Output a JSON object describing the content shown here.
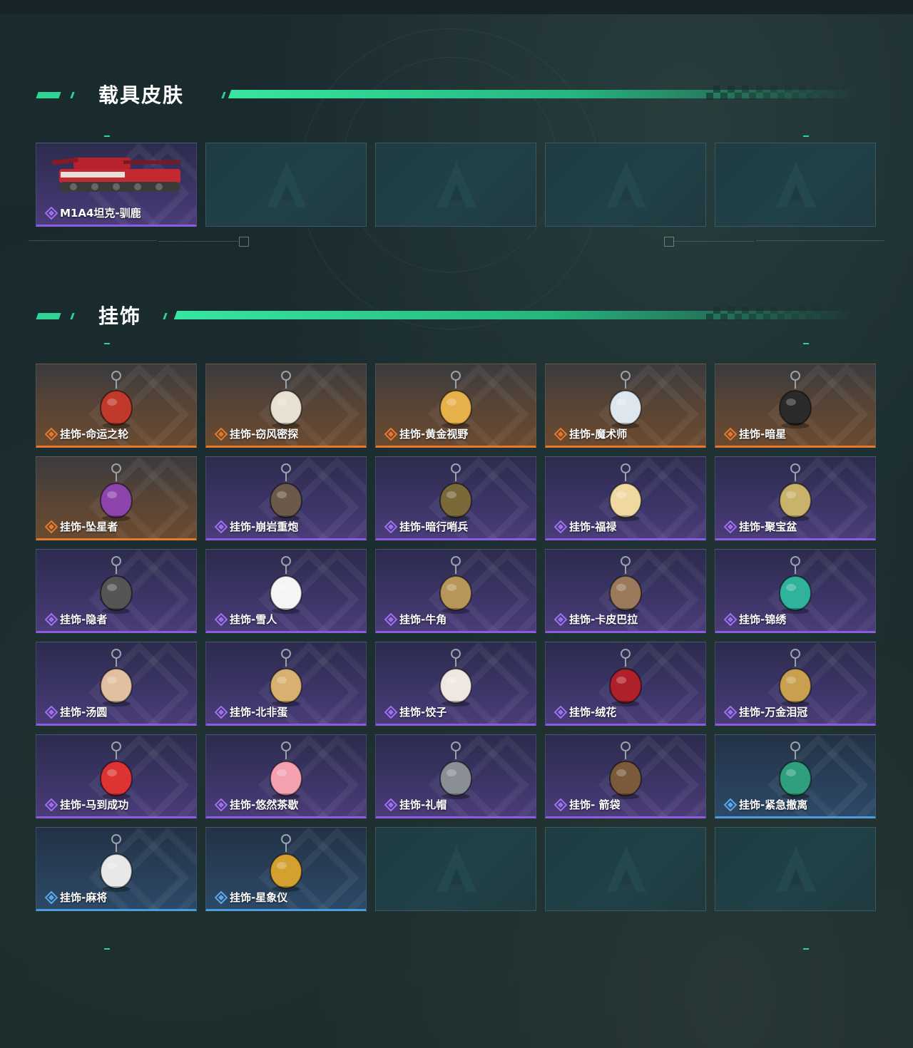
{
  "sections": {
    "vehicle": {
      "title": "载具皮肤",
      "items": [
        {
          "label": "M1A4坦克-驯鹿",
          "rarity": "purple"
        }
      ]
    },
    "charms": {
      "title": "挂饰",
      "items": [
        {
          "label": "挂饰-命运之轮",
          "rarity": "orange"
        },
        {
          "label": "挂饰-窃风密探",
          "rarity": "orange"
        },
        {
          "label": "挂饰-黄金视野",
          "rarity": "orange"
        },
        {
          "label": "挂饰-魔术师",
          "rarity": "orange"
        },
        {
          "label": "挂饰-暗星",
          "rarity": "orange"
        },
        {
          "label": "挂饰-坠星者",
          "rarity": "orange"
        },
        {
          "label": "挂饰-崩岩重炮",
          "rarity": "purple"
        },
        {
          "label": "挂饰-暗行哨兵",
          "rarity": "purple"
        },
        {
          "label": "挂饰-福禄",
          "rarity": "purple"
        },
        {
          "label": "挂饰-聚宝盆",
          "rarity": "purple"
        },
        {
          "label": "挂饰-隐者",
          "rarity": "purple"
        },
        {
          "label": "挂饰-雪人",
          "rarity": "purple"
        },
        {
          "label": "挂饰-牛角",
          "rarity": "purple"
        },
        {
          "label": "挂饰-卡皮巴拉",
          "rarity": "purple"
        },
        {
          "label": "挂饰-锦绣",
          "rarity": "purple"
        },
        {
          "label": "挂饰-汤圆",
          "rarity": "purple"
        },
        {
          "label": "挂饰-北非蛋",
          "rarity": "purple"
        },
        {
          "label": "挂饰-饺子",
          "rarity": "purple"
        },
        {
          "label": "挂饰-绒花",
          "rarity": "purple"
        },
        {
          "label": "挂饰-万金泪冠",
          "rarity": "purple"
        },
        {
          "label": "挂饰-马到成功",
          "rarity": "purple"
        },
        {
          "label": "挂饰-悠然茶歇",
          "rarity": "purple"
        },
        {
          "label": "挂饰-礼帽",
          "rarity": "purple"
        },
        {
          "label": "挂饰- 箭袋",
          "rarity": "purple"
        },
        {
          "label": "挂饰-紧急撤离",
          "rarity": "blue"
        },
        {
          "label": "挂饰-麻将",
          "rarity": "blue"
        },
        {
          "label": "挂饰-星象仪",
          "rarity": "blue"
        }
      ]
    }
  },
  "colors": {
    "accent": "#2fd495",
    "orange": "#e8782c",
    "purple": "#8b5be0",
    "blue": "#4a9be0"
  },
  "icons": {
    "rarity_orange": "orange-diamond-icon",
    "rarity_purple": "purple-diamond-icon",
    "rarity_blue": "blue-diamond-icon",
    "empty_slot": "logo-placeholder-icon"
  }
}
